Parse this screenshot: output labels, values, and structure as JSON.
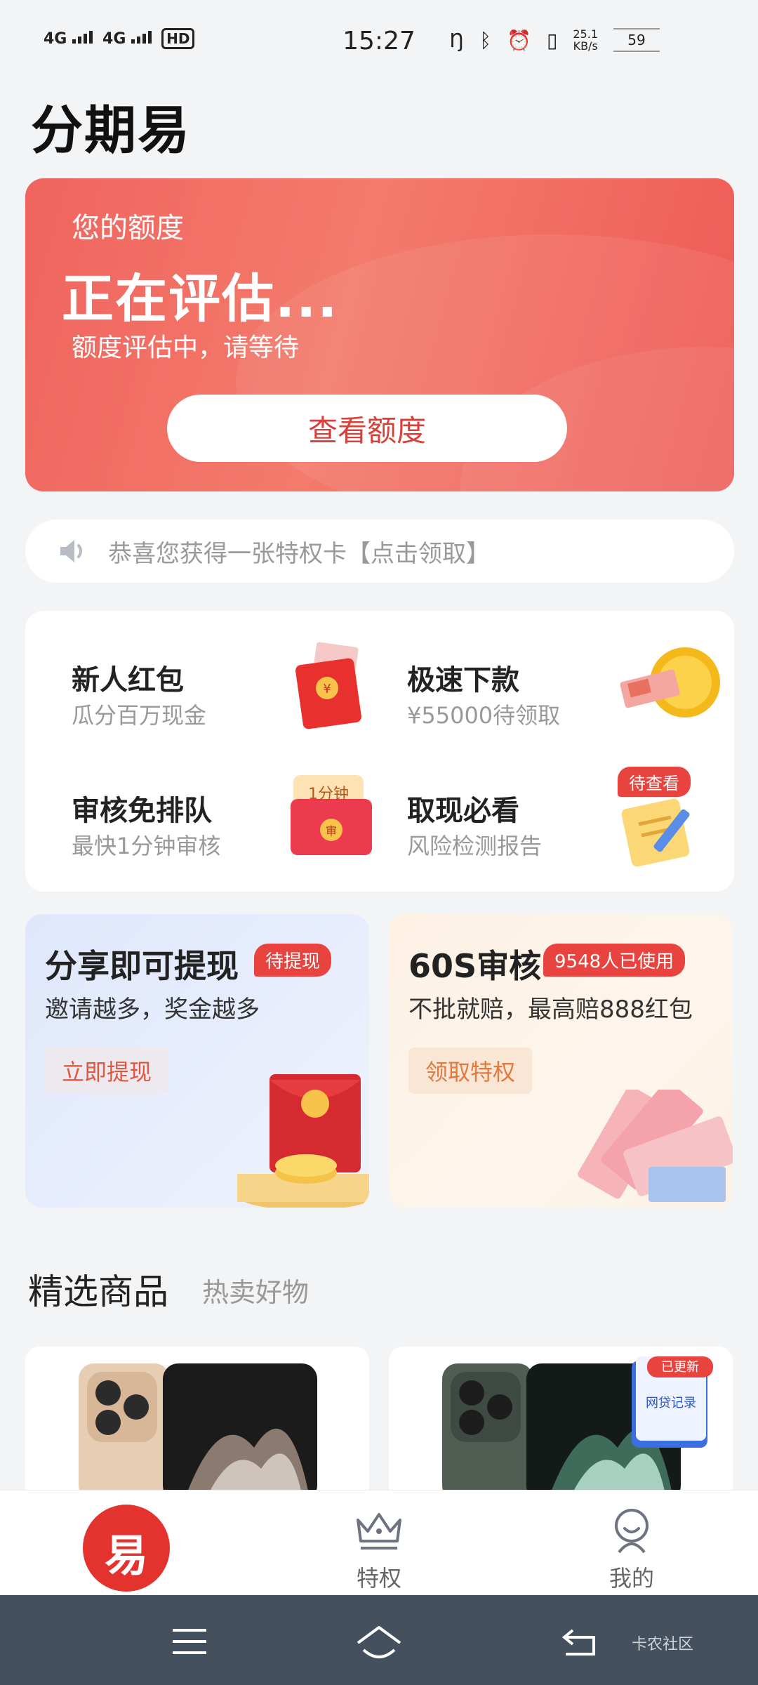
{
  "status_bar": {
    "network_1": "4G",
    "network_2": "4G",
    "hd": "HD",
    "time": "15:27",
    "speed_value": "25.1",
    "speed_unit": "KB/s",
    "battery": "59"
  },
  "app": {
    "title": "分期易"
  },
  "credit": {
    "label": "您的额度",
    "status": "正在评估...",
    "subtitle": "额度评估中，请等待",
    "button": "查看额度"
  },
  "notice": {
    "text": "恭喜您获得一张特权卡【点击领取】"
  },
  "features": [
    {
      "title": "新人红包",
      "subtitle": "瓜分百万现金",
      "icon": "red-envelope-icon"
    },
    {
      "title": "极速下款",
      "subtitle": "¥55000待领取",
      "icon": "gold-coin-icon"
    },
    {
      "title": "审核免排队",
      "subtitle": "最快1分钟审核",
      "icon": "one-minute-envelope-icon",
      "icon_text": "1分钟",
      "icon_seal": "审"
    },
    {
      "title": "取现必看",
      "subtitle": "风险检测报告",
      "icon": "notepad-icon",
      "tag": "待查看"
    }
  ],
  "promos": [
    {
      "title": "分享即可提现",
      "badge": "待提现",
      "subtitle": "邀请越多，奖金越多",
      "button": "立即提现"
    },
    {
      "title": "60S审核",
      "badge": "9548人已使用",
      "subtitle": "不批就赔，最高赔888红包",
      "button": "领取特权"
    }
  ],
  "goods": {
    "heading": "精选商品",
    "subheading": "热卖好物",
    "float_badge_tag": "已更新",
    "float_badge_label": "网贷记录"
  },
  "tabbar": {
    "home_glyph": "易",
    "privilege": "特权",
    "mine": "我的"
  },
  "watermark": "卡农社区",
  "colors": {
    "accent": "#e4322e",
    "card_gradient_start": "#f0645d",
    "card_gradient_end": "#ee5a55",
    "nav_bar": "#45505e"
  }
}
